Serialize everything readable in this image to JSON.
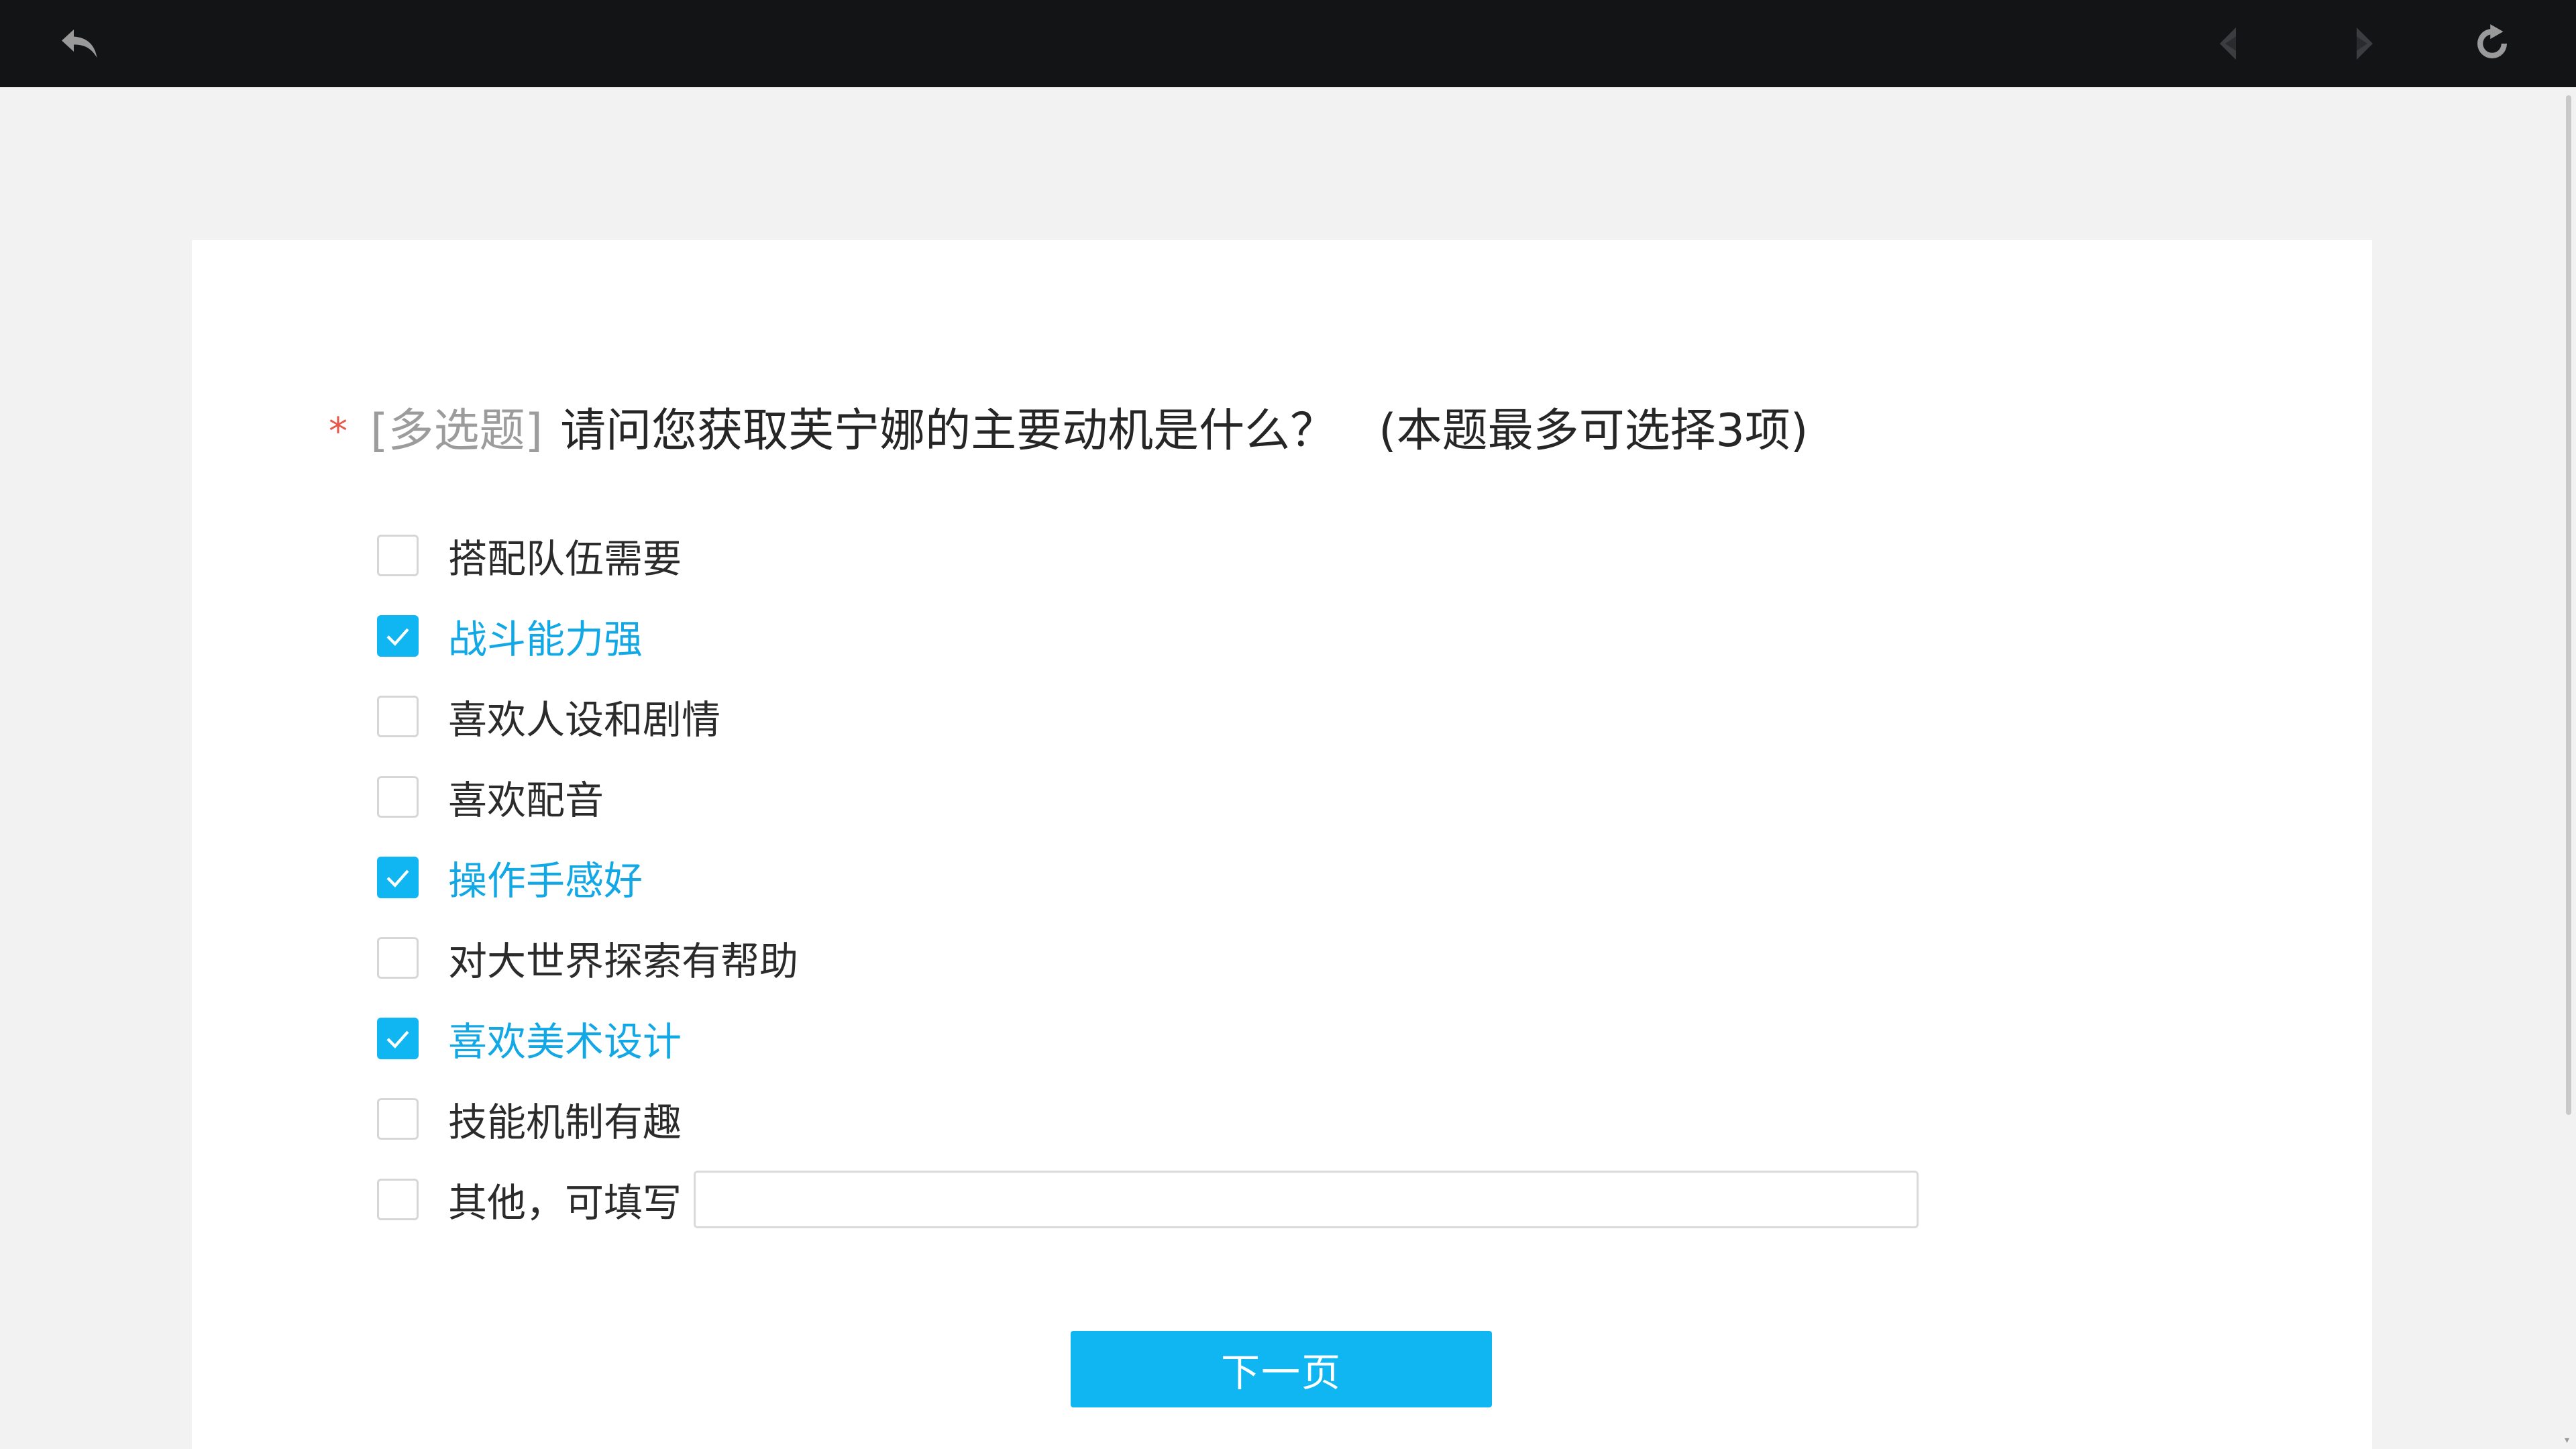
{
  "toolbar": {
    "back_icon": "back-arrow-icon",
    "prev_icon": "prev-arrow-icon",
    "next_icon": "next-arrow-icon",
    "refresh_icon": "refresh-icon"
  },
  "question": {
    "required_mark": "*",
    "type_label": "[多选题]",
    "text": "请问您获取芙宁娜的主要动机是什么？",
    "limit_note": "(本题最多可选择3项)"
  },
  "options": [
    {
      "label": "搭配队伍需要",
      "checked": false
    },
    {
      "label": "战斗能力强",
      "checked": true
    },
    {
      "label": "喜欢人设和剧情",
      "checked": false
    },
    {
      "label": "喜欢配音",
      "checked": false
    },
    {
      "label": "操作手感好",
      "checked": true
    },
    {
      "label": "对大世界探索有帮助",
      "checked": false
    },
    {
      "label": "喜欢美术设计",
      "checked": true
    },
    {
      "label": "技能机制有趣",
      "checked": false
    },
    {
      "label": "其他，可填写",
      "checked": false
    }
  ],
  "other_input": {
    "value": "",
    "placeholder": ""
  },
  "next_button": {
    "label": "下一页"
  },
  "colors": {
    "accent": "#0fb6f2",
    "checked_text": "#12a8e6",
    "required": "#e55a4e",
    "topbar": "#131416",
    "background": "#f2f2f2"
  }
}
